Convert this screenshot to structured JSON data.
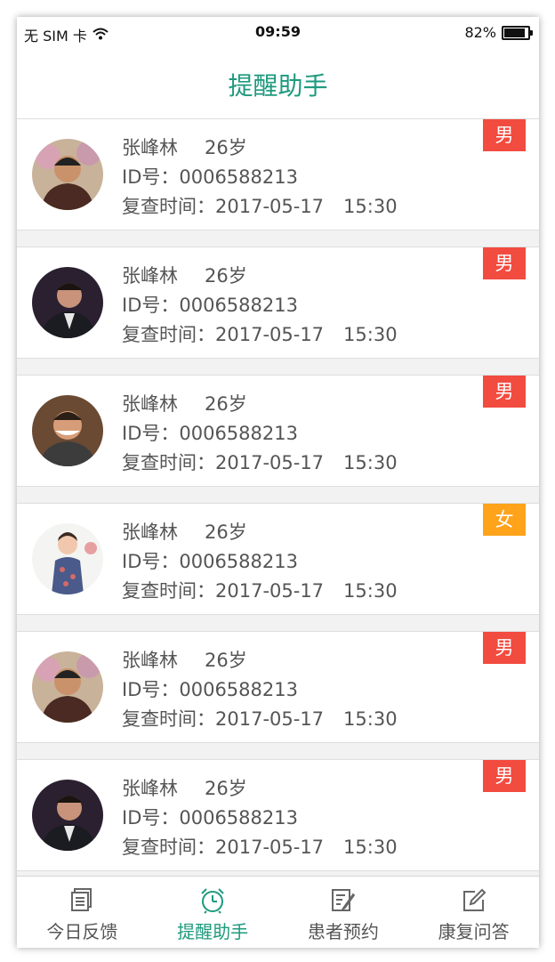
{
  "status_bar": {
    "carrier": "无 SIM 卡",
    "time": "09:59",
    "battery": "82%"
  },
  "header": {
    "title": "提醒助手"
  },
  "colors": {
    "accent": "#1e9a7e",
    "male": "#f24b3f",
    "female": "#ffa31a"
  },
  "patients": [
    {
      "name": "张峰林",
      "age": "26岁",
      "id": "ID号：0006588213",
      "date": "复查时间：2017-05-17",
      "time": "15:30",
      "gender": "男",
      "gender_color": "#f24b3f",
      "avatar": "a"
    },
    {
      "name": "张峰林",
      "age": "26岁",
      "id": "ID号：0006588213",
      "date": "复查时间：2017-05-17",
      "time": "15:30",
      "gender": "男",
      "gender_color": "#f24b3f",
      "avatar": "b"
    },
    {
      "name": "张峰林",
      "age": "26岁",
      "id": "ID号：0006588213",
      "date": "复查时间：2017-05-17",
      "time": "15:30",
      "gender": "男",
      "gender_color": "#f24b3f",
      "avatar": "c"
    },
    {
      "name": "张峰林",
      "age": "26岁",
      "id": "ID号：0006588213",
      "date": "复查时间：2017-05-17",
      "time": "15:30",
      "gender": "女",
      "gender_color": "#ffa31a",
      "avatar": "d"
    },
    {
      "name": "张峰林",
      "age": "26岁",
      "id": "ID号：0006588213",
      "date": "复查时间：2017-05-17",
      "time": "15:30",
      "gender": "男",
      "gender_color": "#f24b3f",
      "avatar": "a"
    },
    {
      "name": "张峰林",
      "age": "26岁",
      "id": "ID号：0006588213",
      "date": "复查时间：2017-05-17",
      "time": "15:30",
      "gender": "男",
      "gender_color": "#f24b3f",
      "avatar": "b"
    }
  ],
  "tabs": [
    {
      "label": "今日反馈",
      "icon": "document-stack-icon",
      "active": false
    },
    {
      "label": "提醒助手",
      "icon": "alarm-clock-icon",
      "active": true
    },
    {
      "label": "患者预约",
      "icon": "notepad-pen-icon",
      "active": false
    },
    {
      "label": "康复问答",
      "icon": "edit-square-icon",
      "active": false
    }
  ]
}
